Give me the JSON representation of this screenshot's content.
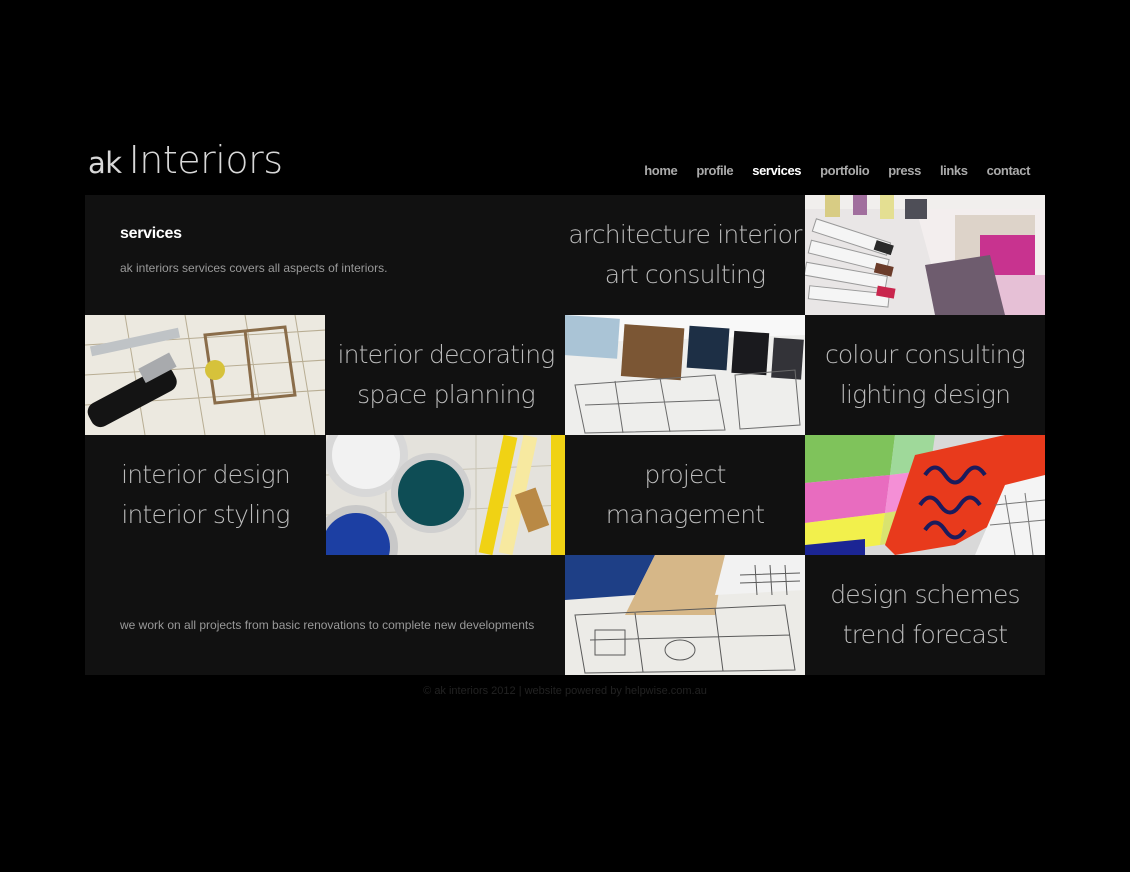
{
  "logo": {
    "prefix": "ak",
    "name": "Interiors"
  },
  "nav": [
    "home",
    "profile",
    "services",
    "portfolio",
    "press",
    "links",
    "contact"
  ],
  "nav_active": "services",
  "intro": {
    "heading": "services",
    "text": "ak interiors services covers all aspects of interiors."
  },
  "tiles": {
    "t1": [
      "architecture interior",
      "art consulting"
    ],
    "t2": [
      "interior decorating",
      "space planning"
    ],
    "t3": [
      "colour consulting",
      "lighting design"
    ],
    "t4": [
      "interior design",
      "interior styling"
    ],
    "t5": [
      "project",
      "management"
    ],
    "t6": [
      "design schemes",
      "trend forecast"
    ]
  },
  "bottom_note": "we work on all projects from basic renovations to complete new developments",
  "footer": "© ak interiors 2012  |  website powered by helpwise.com.au"
}
